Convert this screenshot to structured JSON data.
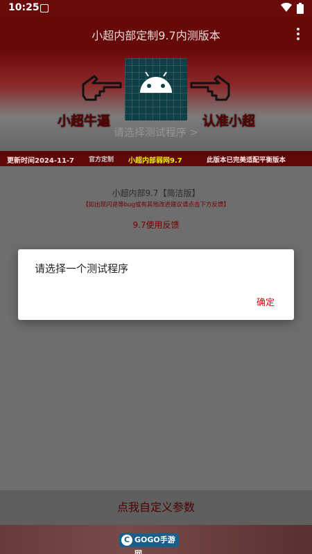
{
  "status_bar": {
    "time": "10:25",
    "wifi_icon": "wifi-icon",
    "battery_icon": "battery-icon",
    "notification_icon": "app-notification-icon"
  },
  "app_bar": {
    "title": "小超内部定制9.7内测版本",
    "menu_icon": "more-vert-icon"
  },
  "banner": {
    "slogan_left": "小超牛逼",
    "slogan_right": "认准小超",
    "choose_program": "请选择测试程序 >",
    "icon": "android-icon"
  },
  "info_strip": {
    "update_date": "更新时间2024-11-7",
    "mid_text": "官方定制",
    "network": "小超内部弱网9.7",
    "tip": "此版本已完美适配平衡版本"
  },
  "content": {
    "version_line": "小超内部9.7【简洁版】",
    "feedback_hint": "【如出现闪退等bug或有其他改进建议请点击下方反馈】",
    "feedback_link": "9.7使用反馈"
  },
  "bottom_button": {
    "label": "点我自定义参数"
  },
  "footer": {
    "logo_text": "GOGO手游网"
  },
  "dialog": {
    "message": "请选择一个测试程序",
    "ok_label": "确定"
  },
  "colors": {
    "accent": "#d01010",
    "app_bar": "#650909"
  }
}
